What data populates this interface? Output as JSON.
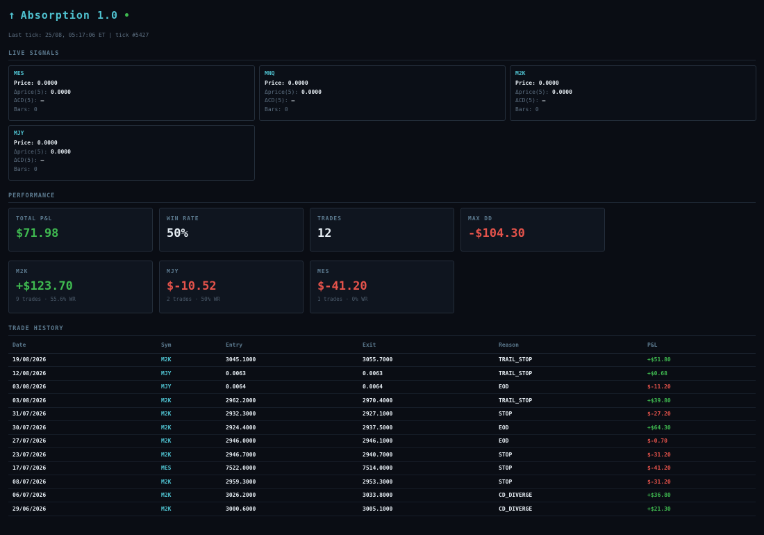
{
  "header": {
    "arrow": "↑",
    "title": "Absorption 1.0",
    "last_tick": "Last tick: 25/08, 05:17:06 ET | tick #5427"
  },
  "sections": {
    "live_signals": "LIVE SIGNALS",
    "performance": "PERFORMANCE",
    "trade_history": "TRADE HISTORY"
  },
  "signal_labels": {
    "price": "Price:",
    "dprice": "Δprice(5):",
    "dcd": "ΔCD(5):",
    "bars": "Bars:"
  },
  "signals": [
    {
      "sym": "MES",
      "price": "0.0000",
      "dprice": "0.0000",
      "dcd": "—",
      "bars": "0"
    },
    {
      "sym": "MNQ",
      "price": "0.0000",
      "dprice": "0.0000",
      "dcd": "—",
      "bars": "0"
    },
    {
      "sym": "M2K",
      "price": "0.0000",
      "dprice": "0.0000",
      "dcd": "—",
      "bars": "0"
    },
    {
      "sym": "MJY",
      "price": "0.0000",
      "dprice": "0.0000",
      "dcd": "—",
      "bars": "0"
    }
  ],
  "performance": {
    "total_pnl": {
      "label": "TOTAL P&L",
      "value": "$71.98"
    },
    "win_rate": {
      "label": "WIN RATE",
      "value": "50%"
    },
    "trades": {
      "label": "TRADES",
      "value": "12"
    },
    "max_dd": {
      "label": "MAX DD",
      "value": "-$104.30"
    }
  },
  "by_symbol": [
    {
      "sym": "M2K",
      "value": "+$123.70",
      "sub": "9 trades · 55.6% WR"
    },
    {
      "sym": "MJY",
      "value": "$-10.52",
      "sub": "2 trades · 50% WR"
    },
    {
      "sym": "MES",
      "value": "$-41.20",
      "sub": "1 trades · 0% WR"
    }
  ],
  "trade_history": {
    "columns": [
      "Date",
      "Sym",
      "Entry",
      "Exit",
      "Reason",
      "P&L"
    ],
    "rows": [
      {
        "date": "19/08/2026",
        "sym": "M2K",
        "entry": "3045.1000",
        "exit": "3055.7000",
        "reason": "TRAIL_STOP",
        "pnl": "+$51.80"
      },
      {
        "date": "12/08/2026",
        "sym": "MJY",
        "entry": "0.0063",
        "exit": "0.0063",
        "reason": "TRAIL_STOP",
        "pnl": "+$0.68"
      },
      {
        "date": "03/08/2026",
        "sym": "MJY",
        "entry": "0.0064",
        "exit": "0.0064",
        "reason": "EOD",
        "pnl": "$-11.20"
      },
      {
        "date": "03/08/2026",
        "sym": "M2K",
        "entry": "2962.2000",
        "exit": "2970.4000",
        "reason": "TRAIL_STOP",
        "pnl": "+$39.80"
      },
      {
        "date": "31/07/2026",
        "sym": "M2K",
        "entry": "2932.3000",
        "exit": "2927.1000",
        "reason": "STOP",
        "pnl": "$-27.20"
      },
      {
        "date": "30/07/2026",
        "sym": "M2K",
        "entry": "2924.4000",
        "exit": "2937.5000",
        "reason": "EOD",
        "pnl": "+$64.30"
      },
      {
        "date": "27/07/2026",
        "sym": "M2K",
        "entry": "2946.0000",
        "exit": "2946.1000",
        "reason": "EOD",
        "pnl": "$-0.70"
      },
      {
        "date": "23/07/2026",
        "sym": "M2K",
        "entry": "2946.7000",
        "exit": "2940.7000",
        "reason": "STOP",
        "pnl": "$-31.20"
      },
      {
        "date": "17/07/2026",
        "sym": "MES",
        "entry": "7522.0000",
        "exit": "7514.0000",
        "reason": "STOP",
        "pnl": "$-41.20"
      },
      {
        "date": "08/07/2026",
        "sym": "M2K",
        "entry": "2959.3000",
        "exit": "2953.3000",
        "reason": "STOP",
        "pnl": "$-31.20"
      },
      {
        "date": "06/07/2026",
        "sym": "M2K",
        "entry": "3026.2000",
        "exit": "3033.8000",
        "reason": "CD_DIVERGE",
        "pnl": "+$36.80"
      },
      {
        "date": "29/06/2026",
        "sym": "M2K",
        "entry": "3000.6000",
        "exit": "3005.1000",
        "reason": "CD_DIVERGE",
        "pnl": "+$21.30"
      }
    ]
  },
  "colors": {
    "accent": "#4fc1cf",
    "positive": "#3fb950",
    "negative": "#e5534b",
    "background": "#0a0d14"
  }
}
